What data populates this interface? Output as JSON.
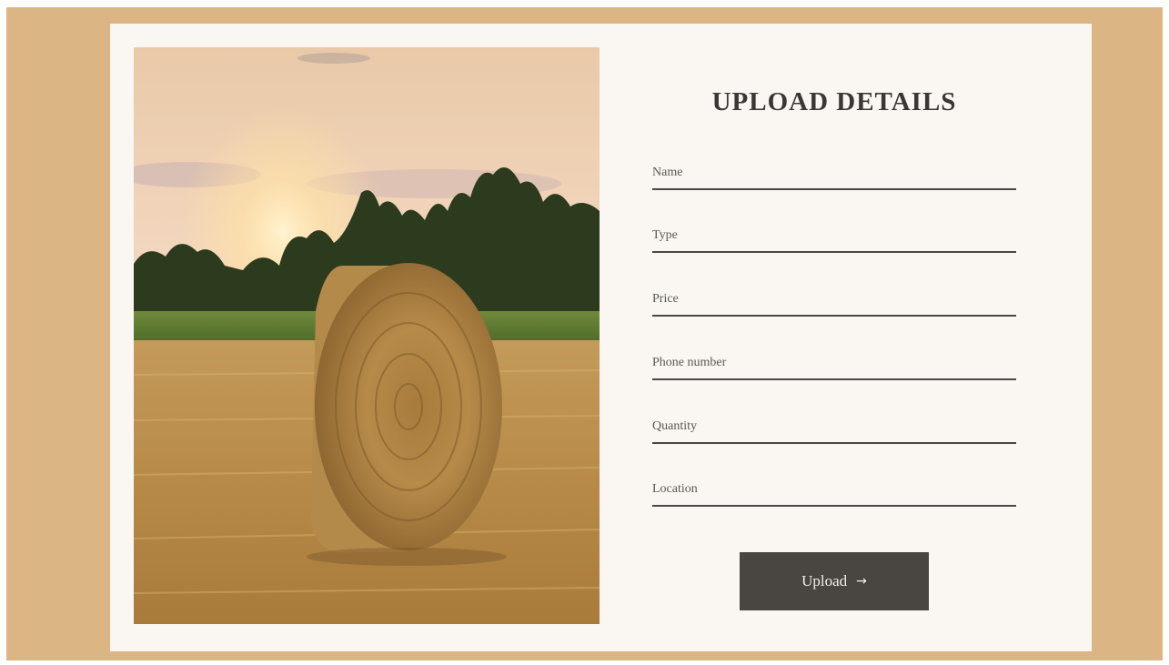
{
  "form": {
    "title": "UPLOAD DETAILS",
    "fields": [
      {
        "key": "name",
        "placeholder": "Name",
        "value": ""
      },
      {
        "key": "type",
        "placeholder": "Type",
        "value": ""
      },
      {
        "key": "price",
        "placeholder": "Price",
        "value": ""
      },
      {
        "key": "phone",
        "placeholder": "Phone number",
        "value": ""
      },
      {
        "key": "quantity",
        "placeholder": "Quantity",
        "value": ""
      },
      {
        "key": "location",
        "placeholder": "Location",
        "value": ""
      }
    ],
    "submit_label": "Upload",
    "submit_icon": "arrow-right-icon"
  },
  "image": {
    "subject": "hay bale in field at sunset"
  },
  "colors": {
    "frame": "#dbb584",
    "card": "#faf7f2",
    "button": "#494641",
    "text": "#3a3734"
  }
}
